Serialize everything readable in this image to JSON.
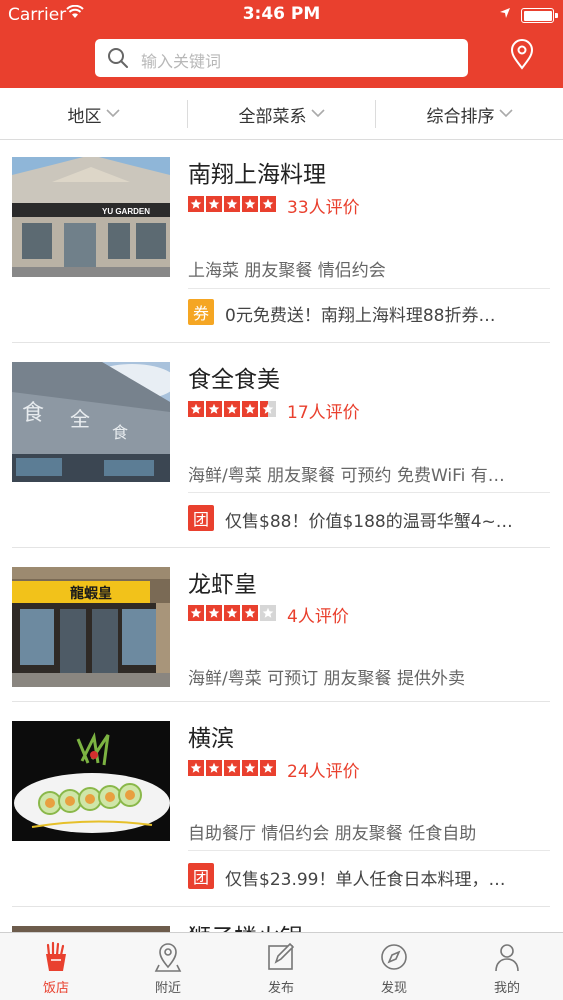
{
  "status_bar": {
    "carrier": "Carrier",
    "time": "3:46 PM"
  },
  "search": {
    "placeholder": "输入关键词"
  },
  "filters": [
    "地区",
    "全部菜系",
    "综合排序"
  ],
  "restaurants": [
    {
      "name": "南翔上海料理",
      "rating": 5,
      "reviews": "33人评价",
      "tags": "上海菜 朋友聚餐 情侣约会",
      "deal_badge": "券",
      "deal_text": "0元免费送！南翔上海料理88折券…",
      "sign_text": "YU GARDEN"
    },
    {
      "name": "食全食美",
      "rating": 4.5,
      "reviews": "17人评价",
      "tags": "海鲜/粤菜 朋友聚餐 可预约 免费WiFi 有…",
      "deal_badge": "团",
      "deal_text": "仅售$88！价值$188的温哥华蟹4~…"
    },
    {
      "name": "龙虾皇",
      "rating": 4,
      "reviews": "4人评价",
      "tags": "海鲜/粤菜 可预订 朋友聚餐 提供外卖",
      "sign_text": "龍蝦皇"
    },
    {
      "name": "横滨",
      "rating": 5,
      "reviews": "24人评价",
      "tags": "自助餐厅 情侣约会 朋友聚餐 任食自助",
      "deal_badge": "团",
      "deal_text": "仅售$23.99！单人任食日本料理，…"
    }
  ],
  "partial_next": "狮子楼火锅",
  "tabs": [
    {
      "label": "饭店",
      "icon": "fries-icon",
      "active": true
    },
    {
      "label": "附近",
      "icon": "location-pin-icon"
    },
    {
      "label": "发布",
      "icon": "edit-icon"
    },
    {
      "label": "发现",
      "icon": "compass-icon"
    },
    {
      "label": "我的",
      "icon": "person-icon"
    }
  ],
  "colors": {
    "brand": "#e9402e",
    "coupon": "#f5a623"
  }
}
